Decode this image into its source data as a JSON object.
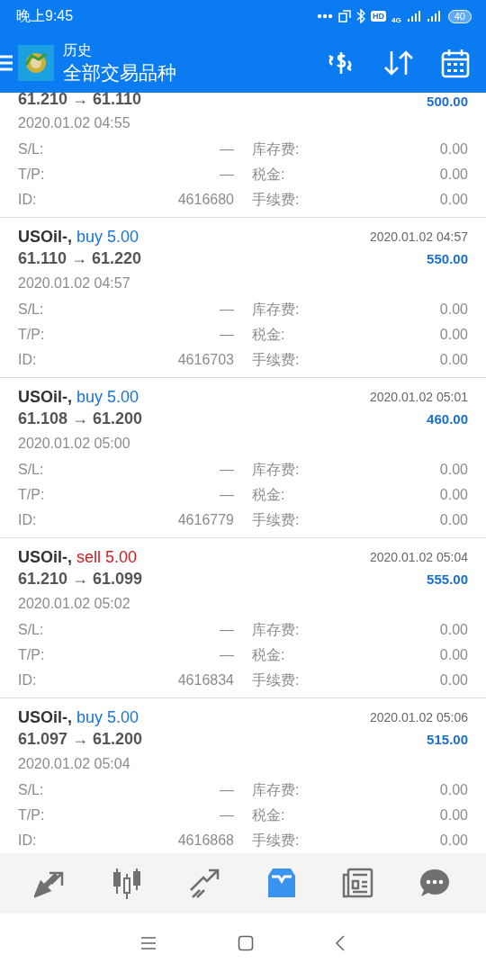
{
  "status_bar": {
    "time": "晚上9:45",
    "hd": "HD",
    "network": "4G",
    "battery": "40"
  },
  "app_bar": {
    "title": "历史",
    "subtitle": "全部交易品种"
  },
  "deals": [
    {
      "prices": "61.210 → 61.110",
      "profit": "500.00",
      "open_time": "2020.01.02 04:55",
      "details": [
        {
          "label": "S/L:",
          "value": "—"
        },
        {
          "label": "库存费:",
          "value": "0.00"
        },
        {
          "label": "T/P:",
          "value": "—"
        },
        {
          "label": "税金:",
          "value": "0.00"
        },
        {
          "label": "ID:",
          "value": "4616680"
        },
        {
          "label": "手续费:",
          "value": "0.00"
        }
      ]
    },
    {
      "symbol": "USOil-,",
      "kind": "buy",
      "trade": "buy 5.00",
      "close_time": "2020.01.02 04:57",
      "prices": "61.110 → 61.220",
      "profit": "550.00",
      "open_time": "2020.01.02 04:57",
      "details": [
        {
          "label": "S/L:",
          "value": "—"
        },
        {
          "label": "库存费:",
          "value": "0.00"
        },
        {
          "label": "T/P:",
          "value": "—"
        },
        {
          "label": "税金:",
          "value": "0.00"
        },
        {
          "label": "ID:",
          "value": "4616703"
        },
        {
          "label": "手续费:",
          "value": "0.00"
        }
      ]
    },
    {
      "symbol": "USOil-,",
      "kind": "buy",
      "trade": "buy 5.00",
      "close_time": "2020.01.02 05:01",
      "prices": "61.108 → 61.200",
      "profit": "460.00",
      "open_time": "2020.01.02 05:00",
      "details": [
        {
          "label": "S/L:",
          "value": "—"
        },
        {
          "label": "库存费:",
          "value": "0.00"
        },
        {
          "label": "T/P:",
          "value": "—"
        },
        {
          "label": "税金:",
          "value": "0.00"
        },
        {
          "label": "ID:",
          "value": "4616779"
        },
        {
          "label": "手续费:",
          "value": "0.00"
        }
      ]
    },
    {
      "symbol": "USOil-,",
      "kind": "sell",
      "trade": "sell 5.00",
      "close_time": "2020.01.02 05:04",
      "prices": "61.210 → 61.099",
      "profit": "555.00",
      "open_time": "2020.01.02 05:02",
      "details": [
        {
          "label": "S/L:",
          "value": "—"
        },
        {
          "label": "库存费:",
          "value": "0.00"
        },
        {
          "label": "T/P:",
          "value": "—"
        },
        {
          "label": "税金:",
          "value": "0.00"
        },
        {
          "label": "ID:",
          "value": "4616834"
        },
        {
          "label": "手续费:",
          "value": "0.00"
        }
      ]
    },
    {
      "symbol": "USOil-,",
      "kind": "buy",
      "trade": "buy 5.00",
      "close_time": "2020.01.02 05:06",
      "prices": "61.097 → 61.200",
      "profit": "515.00",
      "open_time": "2020.01.02 05:04",
      "details": [
        {
          "label": "S/L:",
          "value": "—"
        },
        {
          "label": "库存费:",
          "value": "0.00"
        },
        {
          "label": "T/P:",
          "value": "—"
        },
        {
          "label": "税金:",
          "value": "0.00"
        },
        {
          "label": "ID:",
          "value": "4616868"
        },
        {
          "label": "手续费:",
          "value": "0.00"
        }
      ]
    }
  ],
  "bottom_nav": [
    {
      "kind": "trade",
      "selected": false
    },
    {
      "kind": "quotes",
      "selected": false
    },
    {
      "kind": "chart",
      "selected": false
    },
    {
      "kind": "history",
      "selected": true
    },
    {
      "kind": "news",
      "selected": false
    },
    {
      "kind": "chat",
      "selected": false
    }
  ]
}
